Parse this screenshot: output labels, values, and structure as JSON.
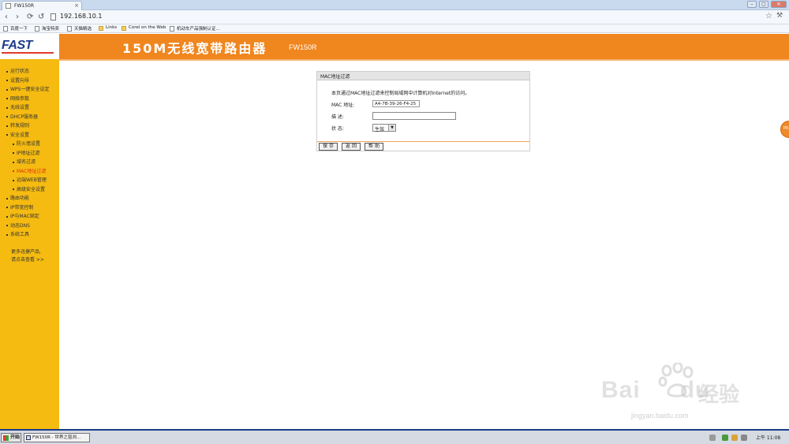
{
  "browser": {
    "tab_title": "FW150R",
    "tab_close": "×",
    "url": "192.168.10.1",
    "bookmarks": [
      "百度一下",
      "淘宝特卖",
      "天猫精选",
      "Links",
      "Corel on the Web",
      "机动车产品强制认证..."
    ]
  },
  "header": {
    "logo": "FAST",
    "title": "150M无线宽带路由器",
    "model": "FW150R"
  },
  "sidebar": {
    "items": [
      {
        "label": "运行状态",
        "sub": false,
        "active": false
      },
      {
        "label": "设置向导",
        "sub": false,
        "active": false
      },
      {
        "label": "WPS一键安全设定",
        "sub": false,
        "active": false
      },
      {
        "label": "网络参数",
        "sub": false,
        "active": false
      },
      {
        "label": "无线设置",
        "sub": false,
        "active": false
      },
      {
        "label": "DHCP服务器",
        "sub": false,
        "active": false
      },
      {
        "label": "转发规则",
        "sub": false,
        "active": false
      },
      {
        "label": "安全设置",
        "sub": false,
        "active": false
      },
      {
        "label": "防火墙设置",
        "sub": true,
        "active": false
      },
      {
        "label": "IP地址过滤",
        "sub": true,
        "active": false
      },
      {
        "label": "域名过滤",
        "sub": true,
        "active": false
      },
      {
        "label": "MAC地址过滤",
        "sub": true,
        "active": true
      },
      {
        "label": "远端WEB管理",
        "sub": true,
        "active": false
      },
      {
        "label": "高级安全设置",
        "sub": true,
        "active": false
      },
      {
        "label": "路由功能",
        "sub": false,
        "active": false
      },
      {
        "label": "IP带宽控制",
        "sub": false,
        "active": false
      },
      {
        "label": "IP与MAC绑定",
        "sub": false,
        "active": false
      },
      {
        "label": "动态DNS",
        "sub": false,
        "active": false
      },
      {
        "label": "系统工具",
        "sub": false,
        "active": false
      }
    ],
    "more_line1": "更多迅捷产品,",
    "more_line2": "请点击查看 >>"
  },
  "panel": {
    "title": "MAC地址过滤",
    "description": "本页通过MAC地址过滤来控制局域网中计算机对Internet的访问。",
    "mac_label": "MAC 地址:",
    "mac_value": "A4-7B-39-26-F4-25",
    "desc_label": "描  述:",
    "desc_value": "",
    "status_label": "状  态:",
    "status_value": "生效",
    "save_label": "保 存",
    "back_label": "返 回",
    "help_label": "帮 助"
  },
  "taskbar": {
    "start_label": "开始",
    "task_label": "FW150R - 世界之窗浏...",
    "clock": "上午 11:08"
  },
  "watermark": {
    "brand": "Bai",
    "brand2": "du",
    "cn": "经验",
    "url": "jingyan.baidu.com"
  }
}
